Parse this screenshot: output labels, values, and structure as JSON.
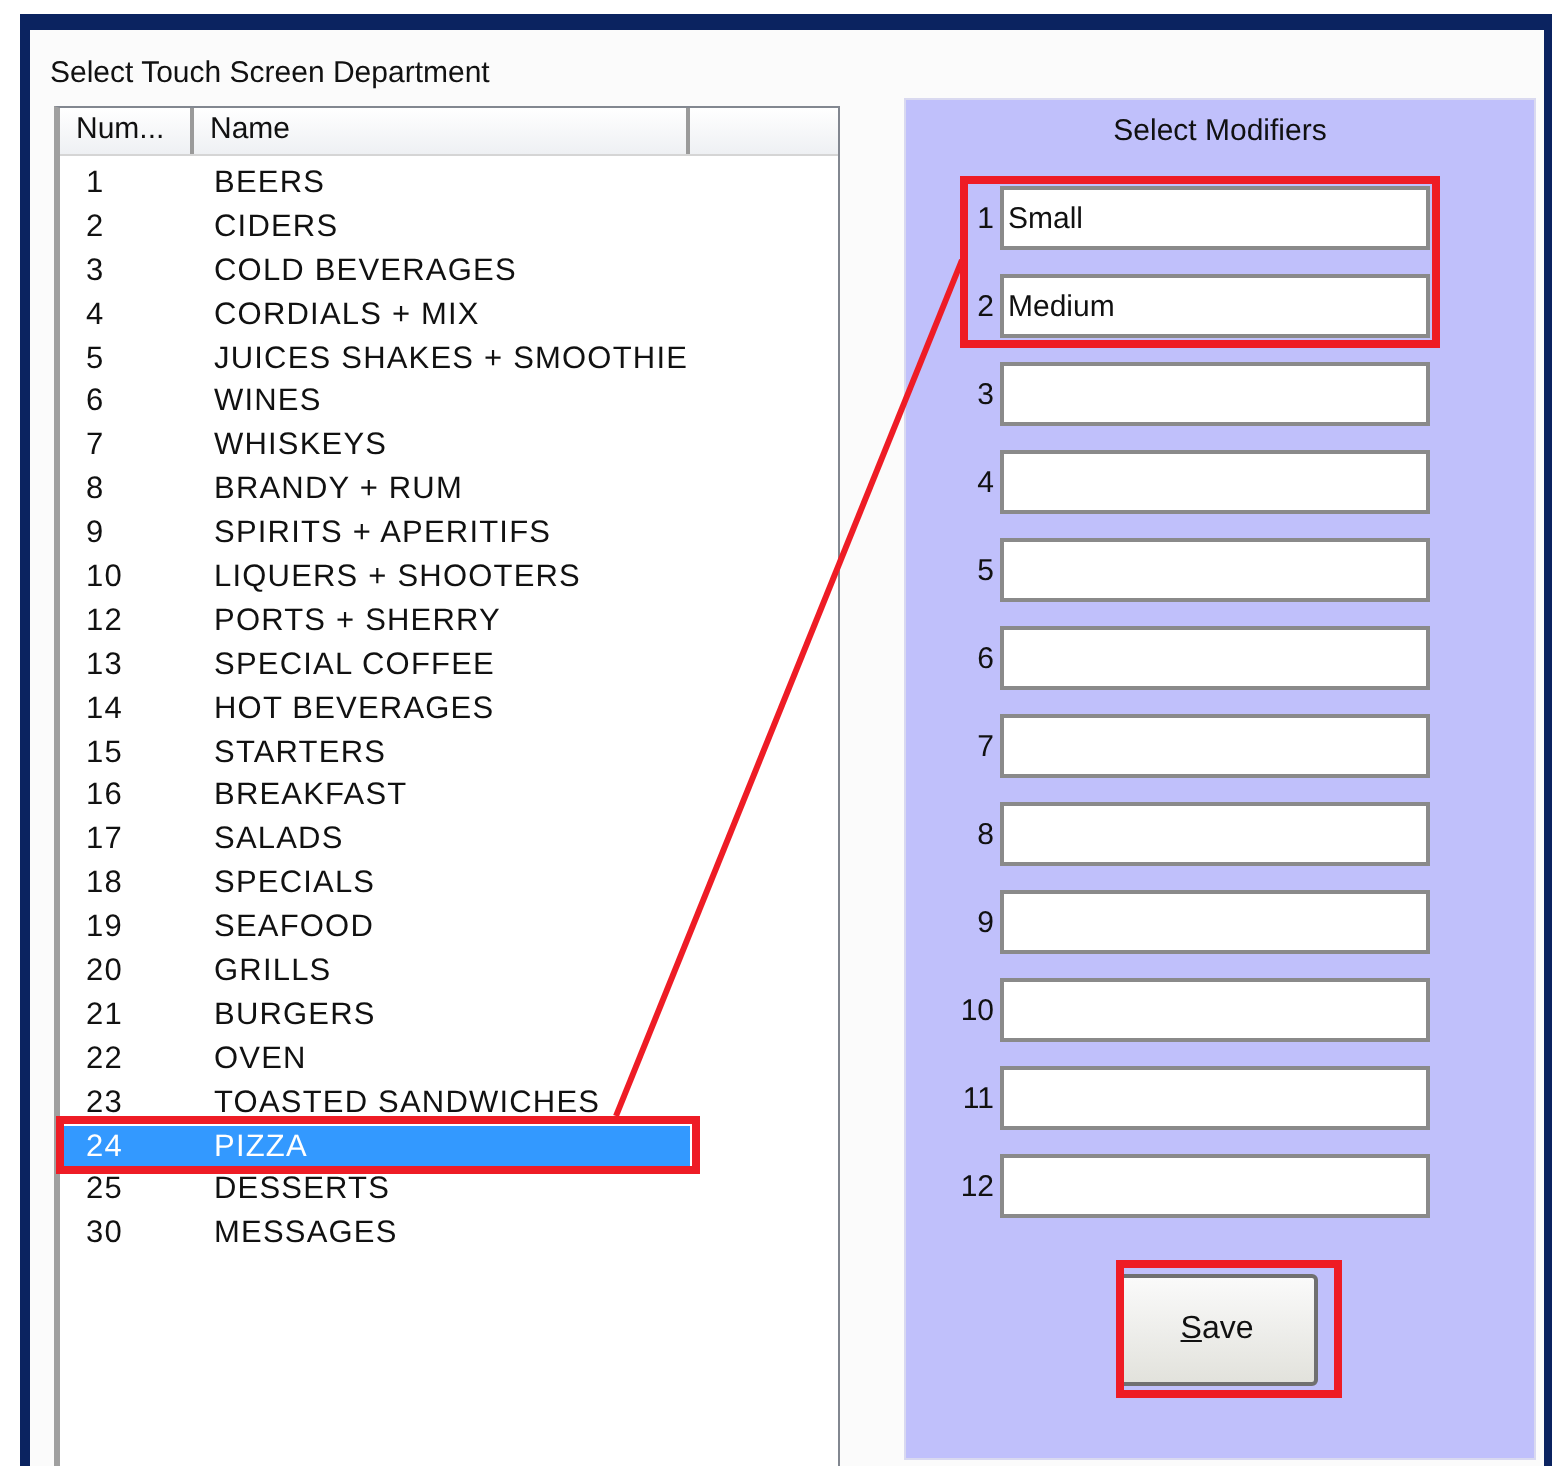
{
  "department_label": "Select Touch Screen Department",
  "table": {
    "columns": [
      "Num...",
      "Name"
    ],
    "rows": [
      {
        "num": "1",
        "name": "BEERS",
        "selected": false
      },
      {
        "num": "2",
        "name": "CIDERS",
        "selected": false
      },
      {
        "num": "3",
        "name": "COLD BEVERAGES",
        "selected": false
      },
      {
        "num": "4",
        "name": "CORDIALS + MIX",
        "selected": false
      },
      {
        "num": "5",
        "name": "JUICES SHAKES + SMOOTHIE",
        "selected": false
      },
      {
        "num": "6",
        "name": "WINES",
        "selected": false
      },
      {
        "num": "7",
        "name": "WHISKEYS",
        "selected": false
      },
      {
        "num": "8",
        "name": "BRANDY + RUM",
        "selected": false
      },
      {
        "num": "9",
        "name": "SPIRITS + APERITIFS",
        "selected": false
      },
      {
        "num": "10",
        "name": "LIQUERS + SHOOTERS",
        "selected": false
      },
      {
        "num": "12",
        "name": "PORTS + SHERRY",
        "selected": false
      },
      {
        "num": "13",
        "name": "SPECIAL COFFEE",
        "selected": false
      },
      {
        "num": "14",
        "name": "HOT BEVERAGES",
        "selected": false
      },
      {
        "num": "15",
        "name": "STARTERS",
        "selected": false
      },
      {
        "num": "16",
        "name": "BREAKFAST",
        "selected": false
      },
      {
        "num": "17",
        "name": "SALADS",
        "selected": false
      },
      {
        "num": "18",
        "name": "SPECIALS",
        "selected": false
      },
      {
        "num": "19",
        "name": "SEAFOOD",
        "selected": false
      },
      {
        "num": "20",
        "name": "GRILLS",
        "selected": false
      },
      {
        "num": "21",
        "name": "BURGERS",
        "selected": false
      },
      {
        "num": "22",
        "name": "OVEN",
        "selected": false
      },
      {
        "num": "23",
        "name": "TOASTED SANDWICHES",
        "selected": false
      },
      {
        "num": "24",
        "name": "PIZZA",
        "selected": true
      },
      {
        "num": "25",
        "name": "DESSERTS",
        "selected": false
      },
      {
        "num": "30",
        "name": "MESSAGES",
        "selected": false
      }
    ]
  },
  "modifiers_panel": {
    "title": "Select Modifiers",
    "modifiers": [
      {
        "label": "1",
        "value": "Small"
      },
      {
        "label": "2",
        "value": "Medium"
      },
      {
        "label": "3"
      },
      {
        "label": "4"
      },
      {
        "label": "5"
      },
      {
        "label": "6"
      },
      {
        "label": "7"
      },
      {
        "label": "8"
      },
      {
        "label": "9"
      },
      {
        "label": "10"
      },
      {
        "label": "11"
      },
      {
        "label": "12"
      }
    ],
    "save_button": {
      "mnemonic": "S",
      "rest": "ave"
    }
  }
}
